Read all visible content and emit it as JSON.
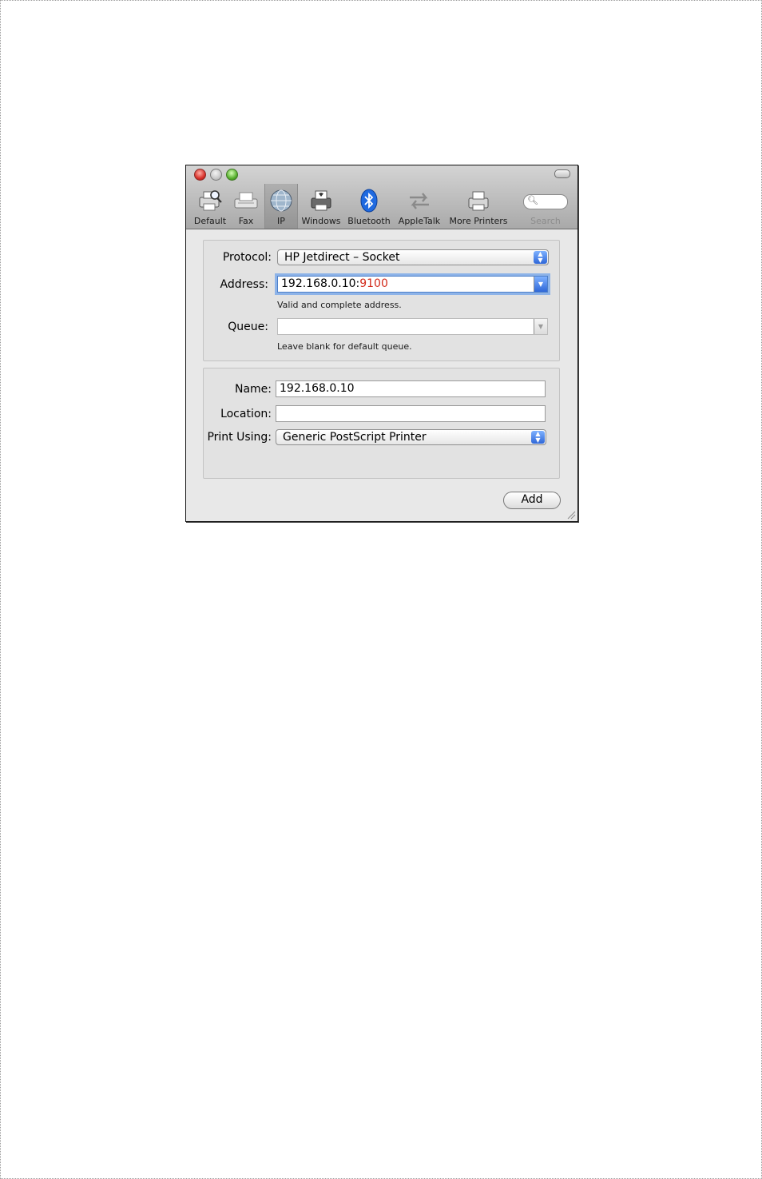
{
  "toolbar": {
    "items": [
      {
        "label": "Default",
        "icon": "printer-magnify-icon"
      },
      {
        "label": "Fax",
        "icon": "fax-icon"
      },
      {
        "label": "IP",
        "icon": "globe-icon"
      },
      {
        "label": "Windows",
        "icon": "windows-printer-icon"
      },
      {
        "label": "Bluetooth",
        "icon": "bluetooth-icon"
      },
      {
        "label": "AppleTalk",
        "icon": "appletalk-arrows-icon"
      },
      {
        "label": "More Printers",
        "icon": "printer-icon"
      },
      {
        "label": "Search",
        "icon": "search-icon"
      }
    ],
    "selected": "IP"
  },
  "protocol": {
    "label": "Protocol:",
    "value": "HP Jetdirect – Socket"
  },
  "address": {
    "label": "Address:",
    "host": "192.168.0.10:",
    "port": "9100",
    "hint": "Valid and complete address."
  },
  "queue": {
    "label": "Queue:",
    "value": "",
    "hint": "Leave blank for default queue."
  },
  "name": {
    "label": "Name:",
    "value": "192.168.0.10"
  },
  "location": {
    "label": "Location:",
    "value": ""
  },
  "print_using": {
    "label": "Print Using:",
    "value": "Generic PostScript Printer"
  },
  "add_button": {
    "label": "Add"
  },
  "colors": {
    "port_highlight": "#d22a1a",
    "focus_ring": "#8db3e8",
    "stepper": "#2f67d8"
  }
}
